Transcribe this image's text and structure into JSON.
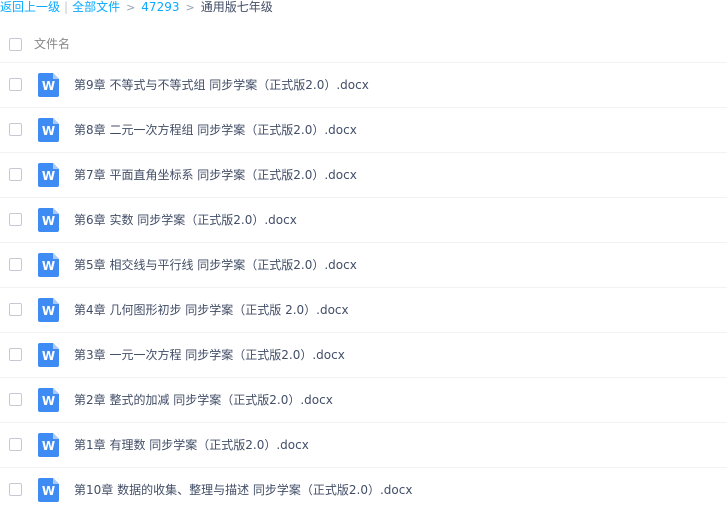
{
  "breadcrumb": {
    "back": "返回上一级",
    "sep": "|",
    "all_files": "全部文件",
    "arrow": ">",
    "folder_id": "47293",
    "current": "通用版七年级"
  },
  "header": {
    "column_label": "文件名"
  },
  "file_icon_letter": "W",
  "files": [
    {
      "name": "第9章 不等式与不等式组 同步学案（正式版2.0）.docx"
    },
    {
      "name": "第8章 二元一次方程组 同步学案（正式版2.0）.docx"
    },
    {
      "name": "第7章 平面直角坐标系 同步学案（正式版2.0）.docx"
    },
    {
      "name": "第6章 实数 同步学案（正式版2.0）.docx"
    },
    {
      "name": "第5章 相交线与平行线 同步学案（正式版2.0）.docx"
    },
    {
      "name": "第4章 几何图形初步 同步学案（正式版 2.0）.docx"
    },
    {
      "name": "第3章 一元一次方程 同步学案（正式版2.0）.docx"
    },
    {
      "name": "第2章 整式的加减 同步学案（正式版2.0）.docx"
    },
    {
      "name": "第1章 有理数 同步学案（正式版2.0）.docx"
    },
    {
      "name": "第10章 数据的收集、整理与描述 同步学案（正式版2.0）.docx"
    }
  ],
  "colors": {
    "link": "#09aaff",
    "word_icon": "#3e8bf4",
    "text": "#424e67"
  },
  "icons": {
    "file_type": "word-doc-icon",
    "select": "checkbox-icon"
  }
}
